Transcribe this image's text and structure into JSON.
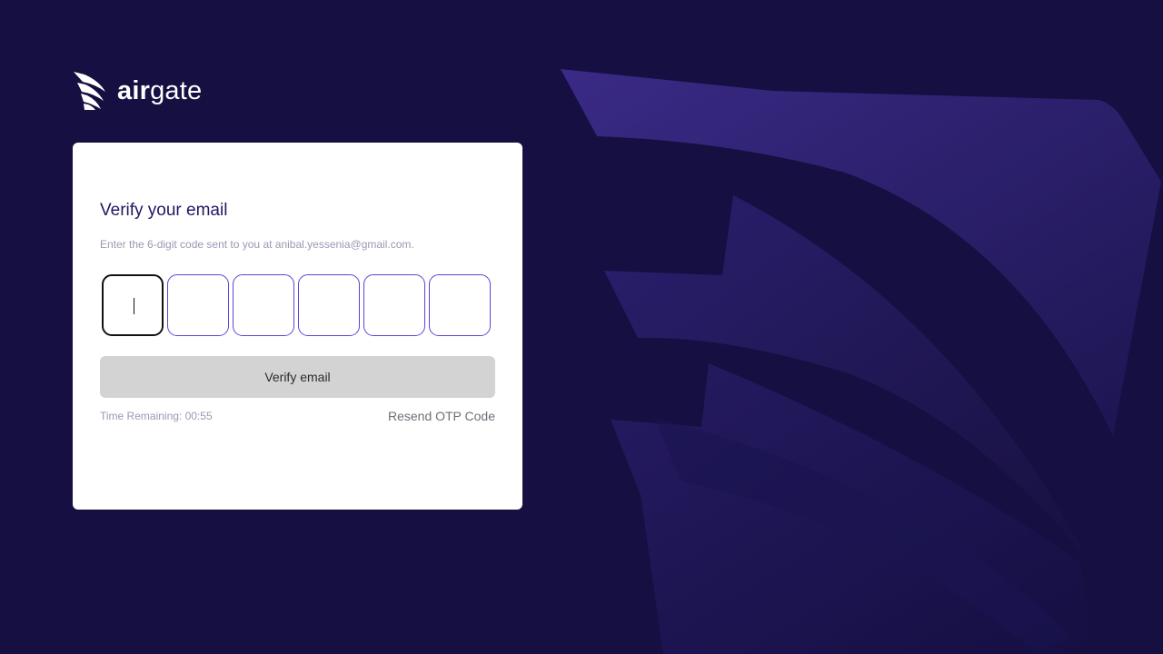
{
  "brand": {
    "name_part1": "air",
    "name_part2": "gate",
    "logo_icon": "airgate-wing-icon"
  },
  "card": {
    "title": "Verify your email",
    "subtitle": "Enter the 6-digit code sent to you at anibal.yessenia@gmail.com.",
    "otp": {
      "length": 6,
      "values": [
        "",
        "",
        "",
        "",
        "",
        ""
      ],
      "focused_index": 0
    },
    "verify_button_label": "Verify email",
    "timer_text": "Time Remaining: 00:55",
    "resend_label": "Resend OTP Code"
  },
  "colors": {
    "page_background": "#150f42",
    "card_background": "#ffffff",
    "title_color": "#1f1863",
    "muted_text": "#9a98b4",
    "otp_border": "#5b45d6",
    "otp_focused_border": "#111111",
    "button_disabled_bg": "#d3d3d3",
    "decor_purple": "#3d2a8c"
  }
}
